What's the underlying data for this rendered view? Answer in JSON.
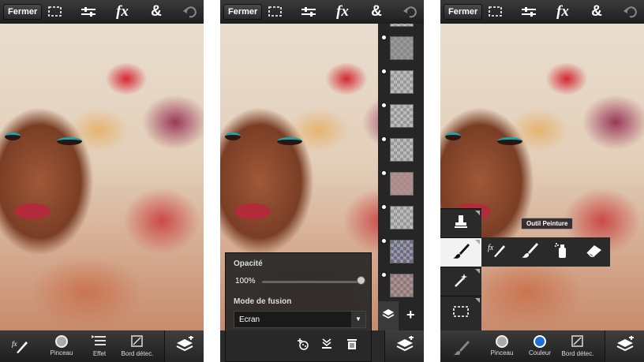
{
  "top_bar": {
    "close_label": "Fermer",
    "fx_label": "fx",
    "amp_label": "&"
  },
  "bottom_bar": {
    "panel1": [
      "Pinceau",
      "Effet",
      "Bord détec."
    ],
    "panel3": [
      "Pinceau",
      "Couleur",
      "Bord détec."
    ]
  },
  "layers_panel": {
    "opacity_label": "Opacité",
    "opacity_value": "100%",
    "opacity_percent": 100,
    "blend_label": "Mode de fusion",
    "blend_value": "Ecran",
    "add_label": "+"
  },
  "tools_panel": {
    "tooltip": "Outil Peinture"
  },
  "colors": {
    "bar": "#2a2a2a",
    "active_tool": "#f2f2f2",
    "selected_color": "#1e6fd6",
    "text": "#ffffff"
  },
  "icons": {
    "top": [
      "selection-icon",
      "adjust-icon",
      "fx-icon",
      "ampersand-icon",
      "undo-icon"
    ],
    "tools": [
      "stamp-icon",
      "brush-icon",
      "magic-wand-icon",
      "selection-icon"
    ],
    "brush_sub": [
      "fx-brush-icon",
      "brush-icon",
      "spray-icon",
      "eraser-icon"
    ]
  }
}
